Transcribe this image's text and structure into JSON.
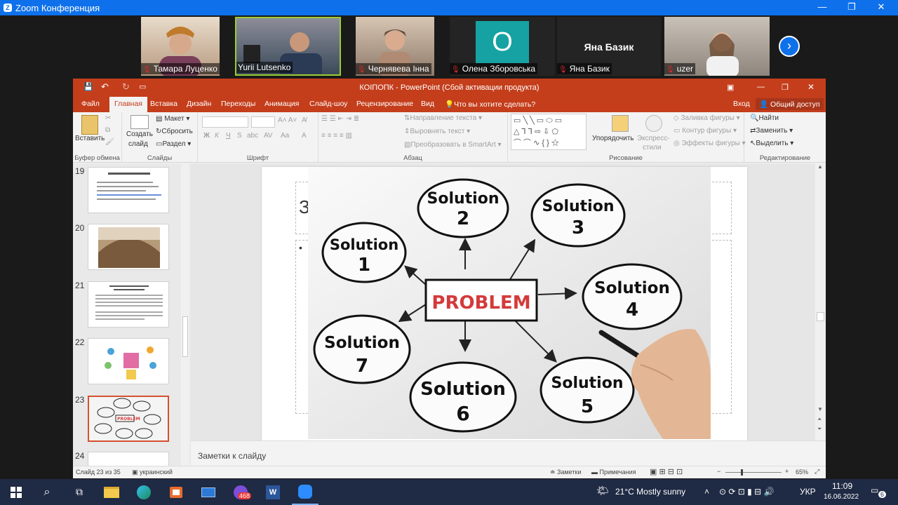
{
  "zoom": {
    "title": "Zoom Конференция",
    "participants": [
      {
        "name": "Тамара Луценко",
        "muted": true
      },
      {
        "name": "Yurii Lutsenko",
        "muted": false
      },
      {
        "name": "Чернявева Інна",
        "muted": true
      },
      {
        "name": "Олена Зборовська",
        "muted": true,
        "avatar_letter": "О"
      },
      {
        "name": "Яна Базик",
        "muted": true,
        "center_label": "Яна Базик"
      },
      {
        "name": "uzer",
        "muted": true
      }
    ]
  },
  "ppt": {
    "title": "КОІПОПК - PowerPoint (Сбой активации продукта)",
    "user": "Вход",
    "share": "Общий доступ",
    "tabs": [
      "Файл",
      "Главная",
      "Вставка",
      "Дизайн",
      "Переходы",
      "Анимация",
      "Слайд-шоу",
      "Рецензирование",
      "Вид"
    ],
    "tell_me": "Что вы хотите сделать?",
    "ribbon": {
      "clipboard": {
        "paste": "Вставить",
        "group": "Буфер обмена"
      },
      "slides": {
        "create_a": "Создать",
        "create_b": "слайд",
        "layout": "Макет",
        "reset": "Сбросить",
        "section": "Раздел",
        "group": "Слайды"
      },
      "font": {
        "group": "Шрифт",
        "bold": "Ж",
        "italic": "К",
        "underline": "Ч",
        "strike": "S",
        "shadow": "abc",
        "spacing": "AV",
        "case": "Aa"
      },
      "paragraph": {
        "group": "Абзац",
        "text_direction": "Направление текста",
        "align_text": "Выровнять текст",
        "smartart": "Преобразовать в SmartArt"
      },
      "drawing": {
        "group": "Рисование",
        "arrange": "Упорядочить",
        "quick_styles_a": "Экспресс-",
        "quick_styles_b": "стили",
        "shape_fill": "Заливка фигуры",
        "shape_outline": "Контур фигуры",
        "shape_effects": "Эффекты фигуры"
      },
      "editing": {
        "group": "Редактирование",
        "find": "Найти",
        "replace": "Заменить",
        "select": "Выделить"
      }
    },
    "thumbnails": [
      {
        "num": "19"
      },
      {
        "num": "20"
      },
      {
        "num": "21"
      },
      {
        "num": "22"
      },
      {
        "num": "23"
      },
      {
        "num": "24"
      }
    ],
    "slide": {
      "title_partial": "З",
      "bullet": "•",
      "diagram": {
        "center": "PROBLEM",
        "solutions": [
          {
            "label": "Solution",
            "num": "2"
          },
          {
            "label": "Solution",
            "num": "3"
          },
          {
            "label": "Solution",
            "num": "1"
          },
          {
            "label": "Solution",
            "num": "4"
          },
          {
            "label": "Solution",
            "num": "7"
          },
          {
            "label": "Solution",
            "num": "6"
          },
          {
            "label": "Solution",
            "num": "5"
          }
        ]
      }
    },
    "notes_placeholder": "Заметки к слайду",
    "status": {
      "slide": "Слайд 23 из 35",
      "lang": "украинский",
      "notes": "Заметки",
      "comments": "Примечания",
      "zoom": "65%"
    }
  },
  "taskbar": {
    "badge_viber": "468",
    "weather": "21°C  Mostly sunny",
    "lang": "УКР",
    "time": "11:09",
    "date": "16.06.2022",
    "notif": "6"
  }
}
